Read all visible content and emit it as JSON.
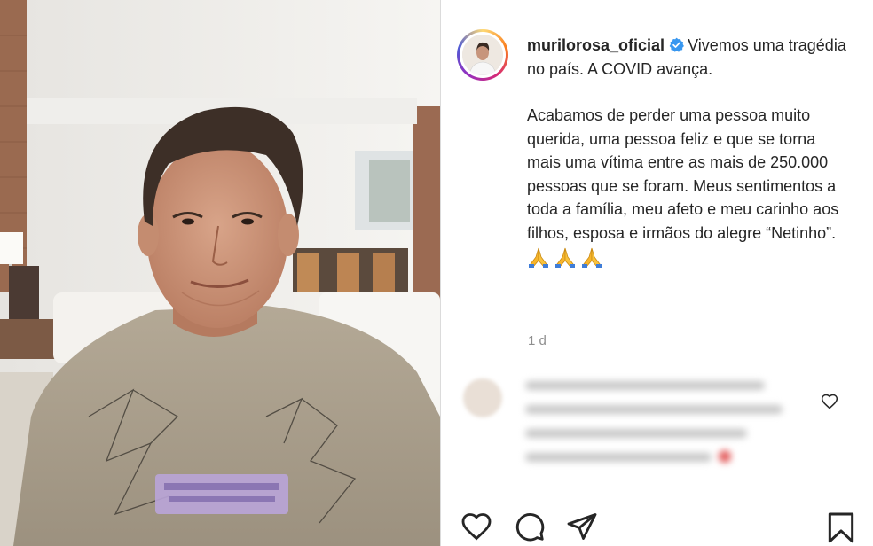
{
  "post": {
    "username": "murilorosa_oficial",
    "caption_lines": [
      "Vivemos uma tragédia no país. A COVID avança.",
      "Acabamos de perder uma pessoa muito querida, uma pessoa feliz e que se torna mais uma vítima entre as mais de 250.000 pessoas que se foram. Meus sentimentos a toda a família, meu afeto e meu carinho aos filhos, esposa e irmãos do alegre “Netinho”."
    ],
    "emoji": "🙏🙏🙏",
    "timestamp": "1 d"
  },
  "icons": {
    "verified": "verified-badge-icon",
    "like": "heart-icon",
    "comment": "comment-icon",
    "share": "paper-plane-icon",
    "save": "bookmark-icon",
    "comment_like": "heart-icon",
    "comment_emoji": "heart-emoji-icon"
  },
  "colors": {
    "text": "#262626",
    "muted": "#8e8e8e",
    "verified": "#3897f0",
    "divider": "#dbdbdb"
  }
}
